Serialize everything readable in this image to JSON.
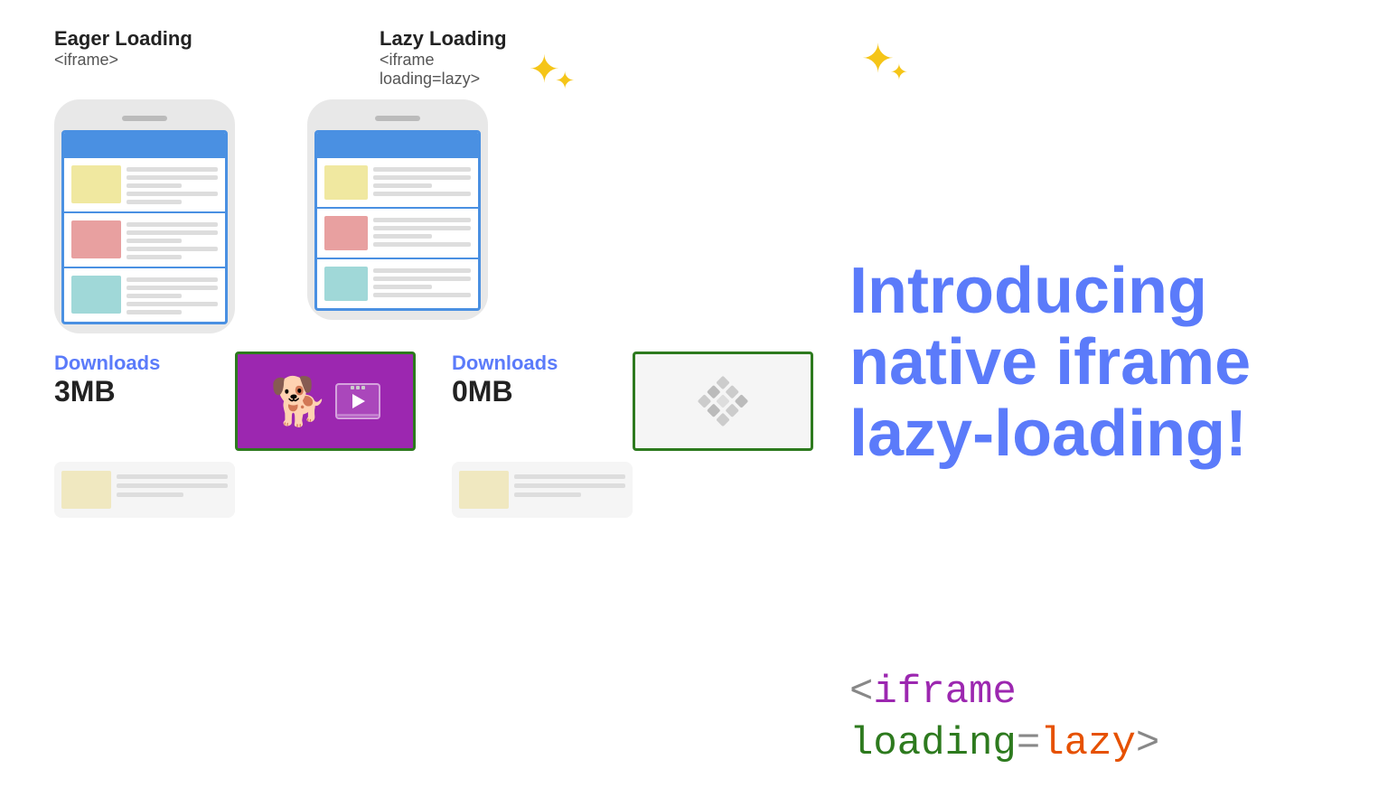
{
  "header": {
    "eager_title": "Eager Loading",
    "eager_code": "<iframe>",
    "lazy_title": "Lazy Loading",
    "lazy_code": "<iframe loading=lazy>"
  },
  "introducing": {
    "line1": "Introducing",
    "line2": "native iframe",
    "line3": "lazy-loading!"
  },
  "code_bottom": {
    "prefix": "<iframe ",
    "attr": "loading",
    "equals": "=",
    "value": "lazy",
    "suffix": ">"
  },
  "downloads_eager": {
    "label": "Downloads",
    "value": "3MB"
  },
  "downloads_lazy": {
    "label": "Downloads",
    "value": "0MB"
  },
  "sparkle_large": "✦",
  "sparkle_small": "✦"
}
